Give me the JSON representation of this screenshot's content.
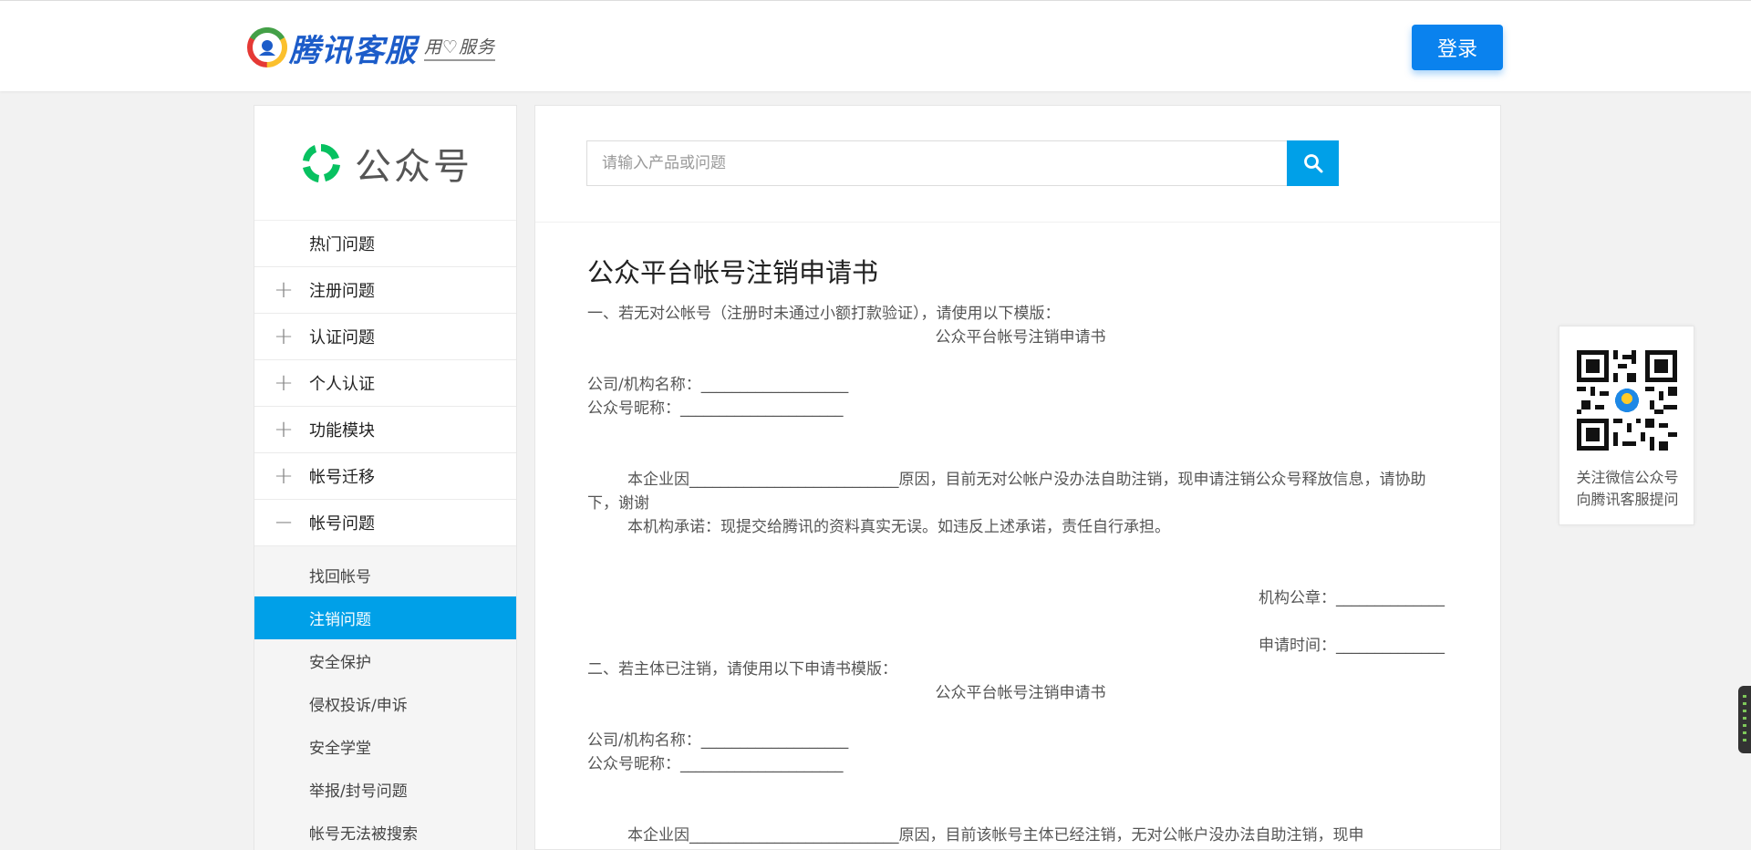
{
  "header": {
    "logo_text": "腾讯客服",
    "logo_slogan": "用♡服务",
    "login_label": "登录",
    "colors": {
      "brand": "#1c5cc9",
      "login_bg": "#0a82ee"
    }
  },
  "sidebar": {
    "product_name": "公众号",
    "nav": [
      {
        "label": "热门问题",
        "expand": ""
      },
      {
        "label": "注册问题",
        "expand": "+"
      },
      {
        "label": "认证问题",
        "expand": "+"
      },
      {
        "label": "个人认证",
        "expand": "+"
      },
      {
        "label": "功能模块",
        "expand": "+"
      },
      {
        "label": "帐号迁移",
        "expand": "+"
      },
      {
        "label": "帐号问题",
        "expand": "−"
      }
    ],
    "sub_items": [
      {
        "label": "找回帐号",
        "active": false
      },
      {
        "label": "注销问题",
        "active": true
      },
      {
        "label": "安全保护",
        "active": false
      },
      {
        "label": "侵权投诉/申诉",
        "active": false
      },
      {
        "label": "安全学堂",
        "active": false
      },
      {
        "label": "举报/封号问题",
        "active": false
      },
      {
        "label": "帐号无法被搜索",
        "active": false
      }
    ],
    "colors": {
      "active": "#00a0e8"
    }
  },
  "search": {
    "placeholder": "请输入产品或问题",
    "button_icon": "search-icon"
  },
  "article": {
    "title": "公众平台帐号注销申请书",
    "section1_intro": "一、若无对公帐号（注册时未通过小额打款验证），请使用以下模版：",
    "section1_heading": "公众平台帐号注销申请书",
    "section1_company": "公司/机构名称：___________________",
    "section1_nickname": "公众号昵称：_____________________",
    "section1_body1": "本企业因___________________________原因，目前无对公帐户没办法自助注销，现申请注销公众号释放信息，请协助下，谢谢",
    "section1_body2": "本机构承诺：现提交给腾讯的资料真实无误。如违反上述承诺，责任自行承担。",
    "section1_seal": "机构公章：______________",
    "section1_date": "申请时间：______________",
    "section2_intro": "二、若主体已注销，请使用以下申请书模版：",
    "section2_heading": "公众平台帐号注销申请书",
    "section2_company": "公司/机构名称：___________________",
    "section2_nickname": "公众号昵称：_____________________",
    "section2_body1": "本企业因___________________________原因，目前该帐号主体已经注销，无对公帐户没办法自助注销，现申"
  },
  "qr_widget": {
    "line1": "关注微信公众号",
    "line2": "向腾讯客服提问",
    "icon": "qr-code-icon"
  }
}
